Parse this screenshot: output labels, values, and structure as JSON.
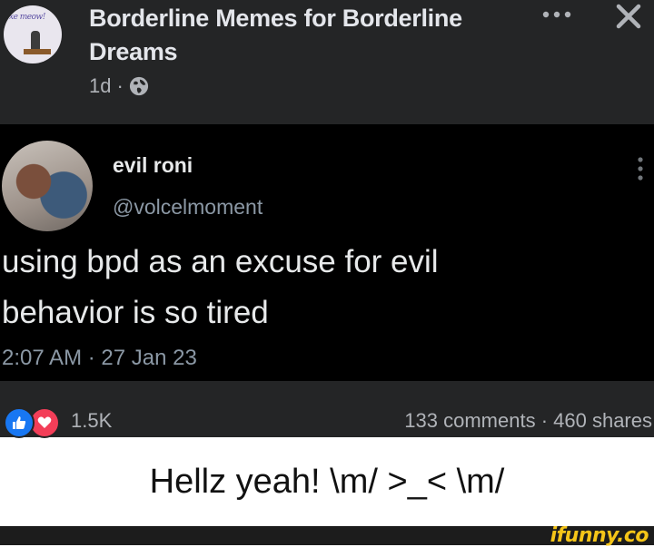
{
  "post": {
    "page_name": "Borderline Memes for Borderline Dreams",
    "avatar_text": "xe meow!",
    "time_ago": "1d",
    "separator": "·",
    "more_icon": "more-horizontal-icon",
    "close_icon": "close-icon",
    "audience_icon": "globe-icon"
  },
  "tweet": {
    "display_name": "evil roni",
    "handle": "@volcelmoment",
    "text_line1": "using bpd as an excuse for evil",
    "text_line2": "behavior is so tired",
    "timestamp": "2:07 AM · 27 Jan 23"
  },
  "reactions": {
    "count": "1.5K",
    "comments_shares": "133 comments · 460 shares",
    "like_color": "#1877f2",
    "love_color": "#f33e58"
  },
  "caption": {
    "text": "Hellz yeah! \\m/ >_< \\m/"
  },
  "watermark": {
    "text": "ifunny.co"
  }
}
